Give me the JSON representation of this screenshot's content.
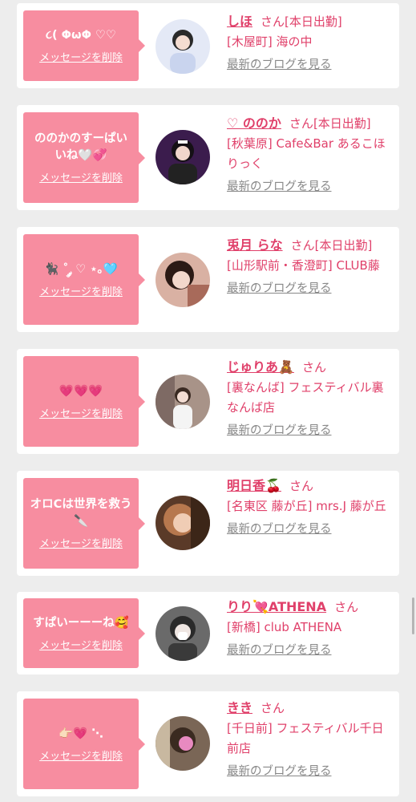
{
  "common": {
    "delete_label": "メッセージを削除",
    "san": "さん",
    "blog_label": "最新のブログを見る",
    "bubble_color": "#f78da0",
    "accent_color": "#e0406a"
  },
  "items": [
    {
      "message": "૮( Φ​ω​Φ ♡♡",
      "name": "しほ",
      "status": "[本日出勤]",
      "shop": "[木屋町] 海の中",
      "avatar_tone": "#dfe6f5"
    },
    {
      "message": "ののかのすーぱいいね🤍💞",
      "name": "♡ ののか",
      "status": "[本日出勤]",
      "shop": "[秋葉原] Cafe&Bar あるこほりっく",
      "avatar_tone": "#3b1c4d"
    },
    {
      "message": "🐈‍⬛ ˚ ༘ ♡ ⋆｡🩵",
      "name": "兎月 らな",
      "status": "[本日出勤]",
      "shop": "[山形駅前・香澄町] CLUB藤",
      "avatar_tone": "#c97c6d"
    },
    {
      "message": "💗💗💗",
      "name": "じゅりあ🧸",
      "status": "",
      "shop": "[裏なんば] フェスティバル裏なんば店",
      "avatar_tone": "#b9a39a"
    },
    {
      "message": "オロCは世界を救う🔪",
      "name": "明日香🍒",
      "status": "",
      "shop": "[名東区 藤が丘] mrs.J 藤が丘",
      "avatar_tone": "#8a5a3c"
    },
    {
      "message": "すぱいーーーね🥰",
      "name": "りり💘ATHENA",
      "status": "",
      "shop": "[新橋] club ATHENA",
      "avatar_tone": "#707070"
    },
    {
      "message": "👉🏻💗 ⋱",
      "name": "きき",
      "status": "",
      "shop": "[千日前] フェスティバル千日前店",
      "avatar_tone": "#6e5a4a"
    }
  ]
}
